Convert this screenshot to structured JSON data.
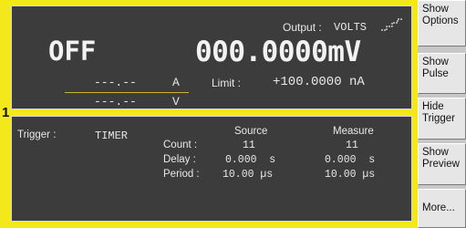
{
  "output": {
    "label": "Output :",
    "mode": "VOLTS"
  },
  "state": "OFF",
  "measurement": {
    "value": "000.0000mV"
  },
  "current_readout": {
    "value": "---.--",
    "unit": "A"
  },
  "voltage_readout": {
    "value": "---.--",
    "unit": "V"
  },
  "limit": {
    "label": "Limit :",
    "value": "+100.0000 nA"
  },
  "pane_number": "1",
  "trigger": {
    "label": "Trigger :",
    "mode": "TIMER",
    "source_header": "Source",
    "measure_header": "Measure",
    "rows": [
      {
        "label": "Count :",
        "source": "11",
        "measure": "11"
      },
      {
        "label": "Delay :",
        "source": "0.000  s",
        "measure": "0.000  s"
      },
      {
        "label": "Period :",
        "source": "10.00 µs",
        "measure": "10.00 µs"
      }
    ]
  },
  "softkeys": [
    {
      "line1": "Show",
      "line2": "Options"
    },
    {
      "line1": "Show",
      "line2": "Pulse"
    },
    {
      "line1": "Hide",
      "line2": "Trigger"
    },
    {
      "line1": "Show",
      "line2": "Preview"
    },
    {
      "line1": "More...",
      "line2": ""
    }
  ],
  "colors": {
    "pane_border": "#f3e81a",
    "panel_bg": "#3c3c3c",
    "accent_line": "#c8b72a"
  },
  "icons": [
    "pulse-waveform-icon"
  ]
}
